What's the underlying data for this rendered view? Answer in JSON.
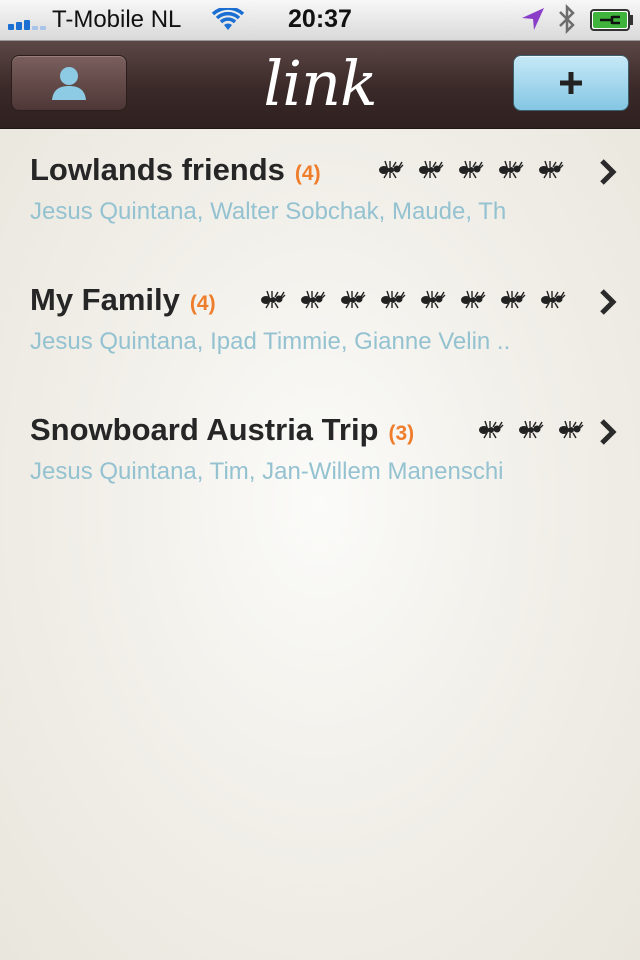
{
  "status_bar": {
    "carrier": "T-Mobile NL",
    "time": "20:37",
    "icons": [
      "signal-icon",
      "wifi-icon",
      "location-arrow-icon",
      "bluetooth-icon",
      "battery-charging-icon"
    ]
  },
  "nav": {
    "title": "link",
    "left_button_icon": "person-icon",
    "right_button_icon": "plus-icon",
    "colors": {
      "bar": "#3a2928",
      "right_button": "#9fd5ec"
    }
  },
  "groups": [
    {
      "name": "Lowlands friends",
      "count": "(4)",
      "members": "Jesus Quintana, Walter Sobchak, Maude, Th",
      "ant_count": 5
    },
    {
      "name": "My Family",
      "count": "(4)",
      "members": "Jesus Quintana, Ipad Timmie, Gianne Velin ..",
      "ant_count": 8
    },
    {
      "name": "Snowboard Austria Trip",
      "count": "(3)",
      "members": "Jesus Quintana, Tim, Jan-Willem Manenschi",
      "ant_count": 3
    }
  ],
  "colors": {
    "count": "#ee7d2c",
    "members": "#94c2d1",
    "title": "#262626"
  }
}
